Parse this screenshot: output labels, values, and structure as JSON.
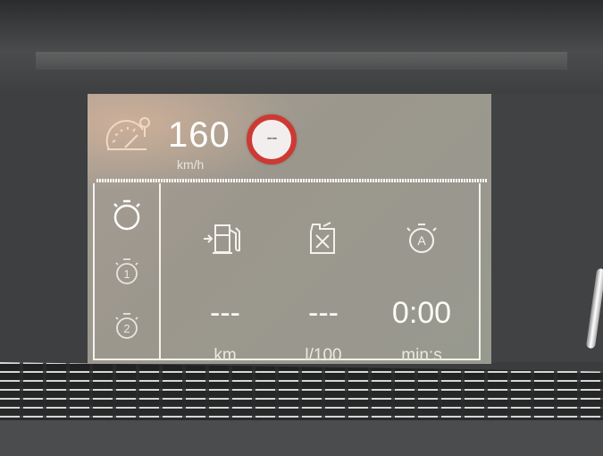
{
  "speed": {
    "value": "160",
    "unit": "km/h"
  },
  "speed_limit": {
    "value": "--"
  },
  "trip": {
    "tabs": [
      {
        "icon": "stopwatch-icon",
        "active": true
      },
      {
        "icon": "stopwatch-1-icon",
        "label": "1"
      },
      {
        "icon": "stopwatch-2-icon",
        "label": "2"
      }
    ],
    "cells": [
      {
        "icon": "fuel-range-icon",
        "value": "---",
        "unit": "km"
      },
      {
        "icon": "fuel-consumption-icon",
        "value": "---",
        "unit": "l/100"
      },
      {
        "icon": "auto-stop-timer-icon",
        "value": "0:00",
        "unit": "min:s"
      }
    ]
  },
  "colors": {
    "limit_ring": "#cc3a33",
    "text": "#ffffff"
  }
}
